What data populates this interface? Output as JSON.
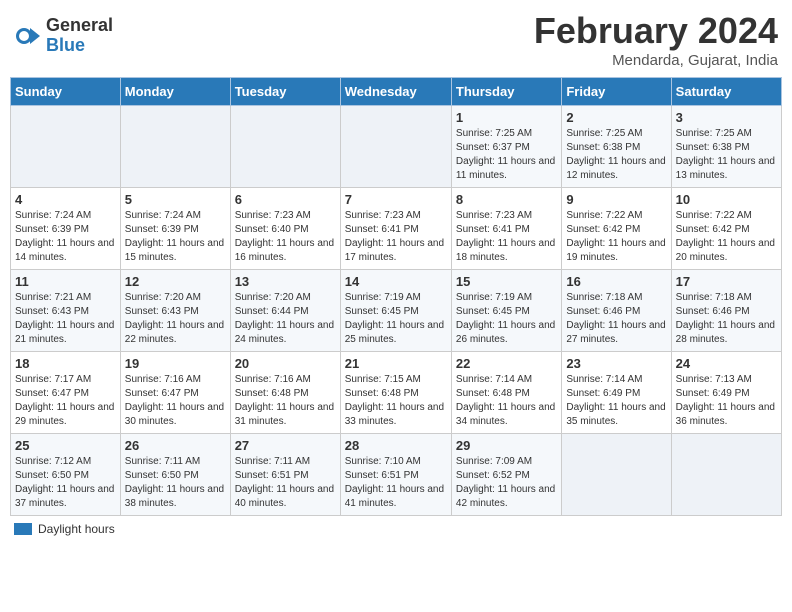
{
  "header": {
    "logo_general": "General",
    "logo_blue": "Blue",
    "title": "February 2024",
    "location": "Mendarda, Gujarat, India"
  },
  "legend": {
    "label": "Daylight hours"
  },
  "weekdays": [
    "Sunday",
    "Monday",
    "Tuesday",
    "Wednesday",
    "Thursday",
    "Friday",
    "Saturday"
  ],
  "weeks": [
    [
      {
        "day": "",
        "info": ""
      },
      {
        "day": "",
        "info": ""
      },
      {
        "day": "",
        "info": ""
      },
      {
        "day": "",
        "info": ""
      },
      {
        "day": "1",
        "info": "Sunrise: 7:25 AM\nSunset: 6:37 PM\nDaylight: 11 hours and 11 minutes."
      },
      {
        "day": "2",
        "info": "Sunrise: 7:25 AM\nSunset: 6:38 PM\nDaylight: 11 hours and 12 minutes."
      },
      {
        "day": "3",
        "info": "Sunrise: 7:25 AM\nSunset: 6:38 PM\nDaylight: 11 hours and 13 minutes."
      }
    ],
    [
      {
        "day": "4",
        "info": "Sunrise: 7:24 AM\nSunset: 6:39 PM\nDaylight: 11 hours and 14 minutes."
      },
      {
        "day": "5",
        "info": "Sunrise: 7:24 AM\nSunset: 6:39 PM\nDaylight: 11 hours and 15 minutes."
      },
      {
        "day": "6",
        "info": "Sunrise: 7:23 AM\nSunset: 6:40 PM\nDaylight: 11 hours and 16 minutes."
      },
      {
        "day": "7",
        "info": "Sunrise: 7:23 AM\nSunset: 6:41 PM\nDaylight: 11 hours and 17 minutes."
      },
      {
        "day": "8",
        "info": "Sunrise: 7:23 AM\nSunset: 6:41 PM\nDaylight: 11 hours and 18 minutes."
      },
      {
        "day": "9",
        "info": "Sunrise: 7:22 AM\nSunset: 6:42 PM\nDaylight: 11 hours and 19 minutes."
      },
      {
        "day": "10",
        "info": "Sunrise: 7:22 AM\nSunset: 6:42 PM\nDaylight: 11 hours and 20 minutes."
      }
    ],
    [
      {
        "day": "11",
        "info": "Sunrise: 7:21 AM\nSunset: 6:43 PM\nDaylight: 11 hours and 21 minutes."
      },
      {
        "day": "12",
        "info": "Sunrise: 7:20 AM\nSunset: 6:43 PM\nDaylight: 11 hours and 22 minutes."
      },
      {
        "day": "13",
        "info": "Sunrise: 7:20 AM\nSunset: 6:44 PM\nDaylight: 11 hours and 24 minutes."
      },
      {
        "day": "14",
        "info": "Sunrise: 7:19 AM\nSunset: 6:45 PM\nDaylight: 11 hours and 25 minutes."
      },
      {
        "day": "15",
        "info": "Sunrise: 7:19 AM\nSunset: 6:45 PM\nDaylight: 11 hours and 26 minutes."
      },
      {
        "day": "16",
        "info": "Sunrise: 7:18 AM\nSunset: 6:46 PM\nDaylight: 11 hours and 27 minutes."
      },
      {
        "day": "17",
        "info": "Sunrise: 7:18 AM\nSunset: 6:46 PM\nDaylight: 11 hours and 28 minutes."
      }
    ],
    [
      {
        "day": "18",
        "info": "Sunrise: 7:17 AM\nSunset: 6:47 PM\nDaylight: 11 hours and 29 minutes."
      },
      {
        "day": "19",
        "info": "Sunrise: 7:16 AM\nSunset: 6:47 PM\nDaylight: 11 hours and 30 minutes."
      },
      {
        "day": "20",
        "info": "Sunrise: 7:16 AM\nSunset: 6:48 PM\nDaylight: 11 hours and 31 minutes."
      },
      {
        "day": "21",
        "info": "Sunrise: 7:15 AM\nSunset: 6:48 PM\nDaylight: 11 hours and 33 minutes."
      },
      {
        "day": "22",
        "info": "Sunrise: 7:14 AM\nSunset: 6:48 PM\nDaylight: 11 hours and 34 minutes."
      },
      {
        "day": "23",
        "info": "Sunrise: 7:14 AM\nSunset: 6:49 PM\nDaylight: 11 hours and 35 minutes."
      },
      {
        "day": "24",
        "info": "Sunrise: 7:13 AM\nSunset: 6:49 PM\nDaylight: 11 hours and 36 minutes."
      }
    ],
    [
      {
        "day": "25",
        "info": "Sunrise: 7:12 AM\nSunset: 6:50 PM\nDaylight: 11 hours and 37 minutes."
      },
      {
        "day": "26",
        "info": "Sunrise: 7:11 AM\nSunset: 6:50 PM\nDaylight: 11 hours and 38 minutes."
      },
      {
        "day": "27",
        "info": "Sunrise: 7:11 AM\nSunset: 6:51 PM\nDaylight: 11 hours and 40 minutes."
      },
      {
        "day": "28",
        "info": "Sunrise: 7:10 AM\nSunset: 6:51 PM\nDaylight: 11 hours and 41 minutes."
      },
      {
        "day": "29",
        "info": "Sunrise: 7:09 AM\nSunset: 6:52 PM\nDaylight: 11 hours and 42 minutes."
      },
      {
        "day": "",
        "info": ""
      },
      {
        "day": "",
        "info": ""
      }
    ]
  ]
}
